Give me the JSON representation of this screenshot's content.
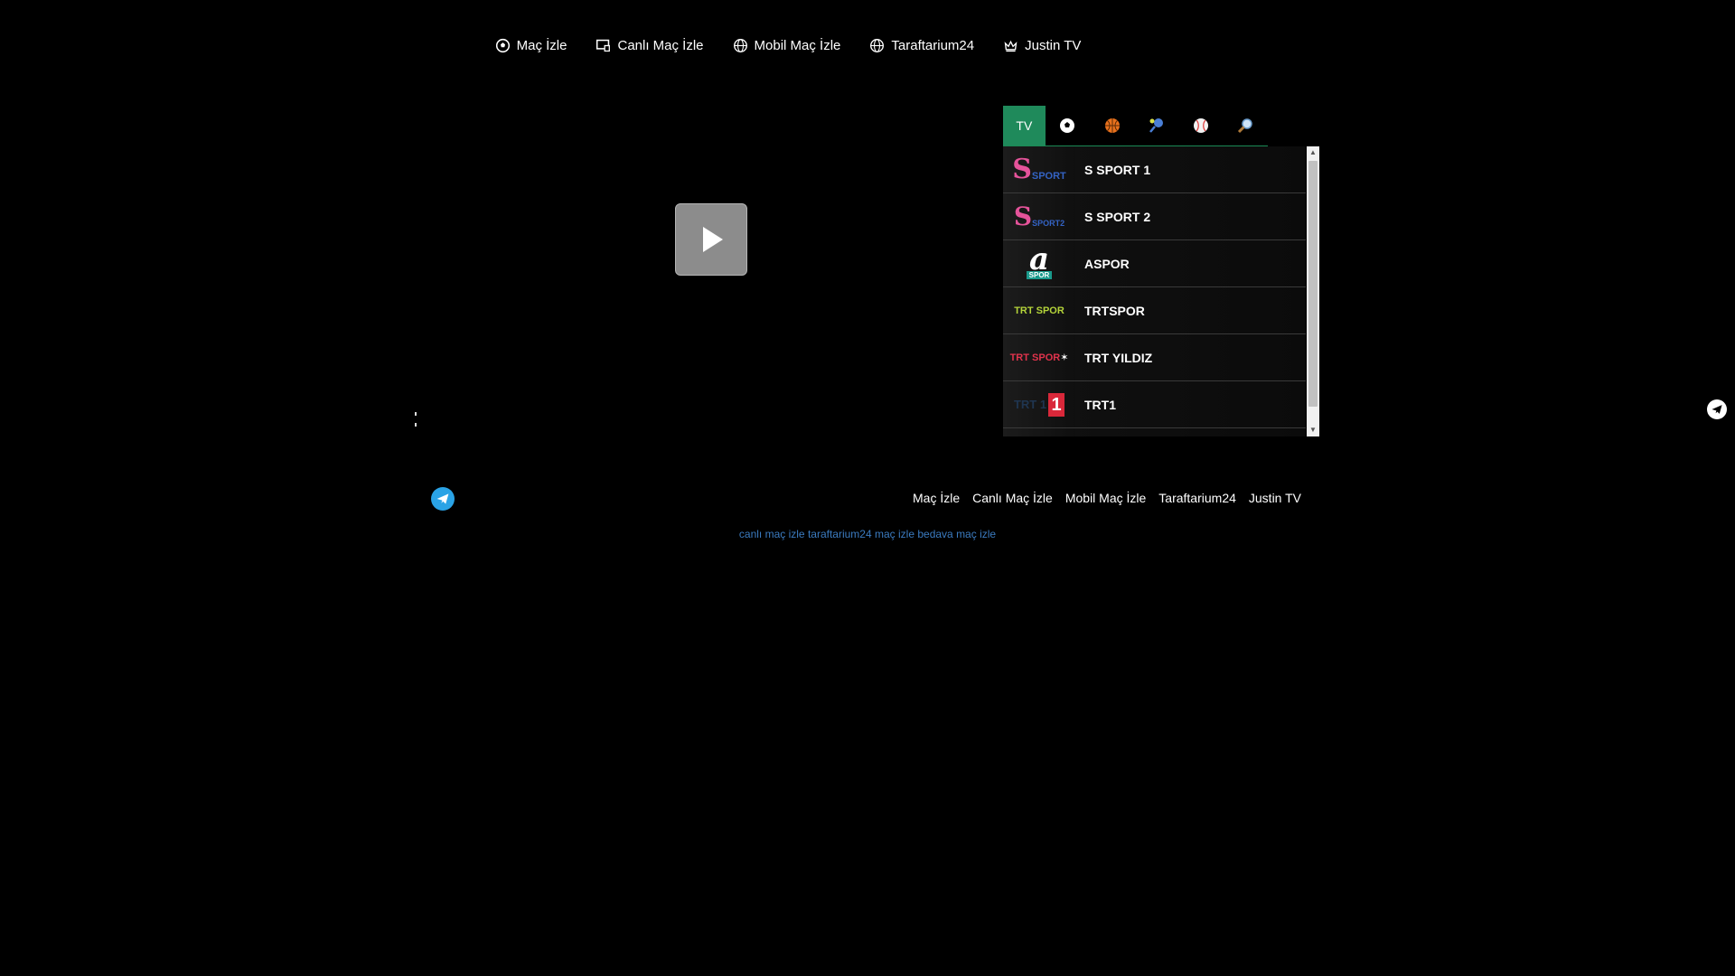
{
  "nav": {
    "items": [
      {
        "label": "Maç İzle",
        "icon": "soccer-ball-icon"
      },
      {
        "label": "Canlı Maç İzle",
        "icon": "screen-icon"
      },
      {
        "label": "Mobil Maç İzle",
        "icon": "globe-icon"
      },
      {
        "label": "Taraftarium24",
        "icon": "globe-icon"
      },
      {
        "label": "Justin TV",
        "icon": "crown-icon"
      }
    ]
  },
  "player": {
    "play_icon": "play-icon"
  },
  "tabs": [
    {
      "label": "TV",
      "icon": ""
    },
    {
      "label": "",
      "icon": "soccer-ball-icon"
    },
    {
      "label": "",
      "icon": "basketball-icon"
    },
    {
      "label": "",
      "icon": "tennis-icon"
    },
    {
      "label": "",
      "icon": "baseball-icon"
    },
    {
      "label": "",
      "icon": "search-icon"
    }
  ],
  "channels": [
    {
      "name": "S SPORT 1",
      "logo_text": "SPORT"
    },
    {
      "name": "S SPORT 2",
      "logo_text": "SPORT2"
    },
    {
      "name": "ASPOR",
      "logo_text": "SPOR"
    },
    {
      "name": "TRTSPOR",
      "logo_text": "TRT SPOR"
    },
    {
      "name": "TRT YILDIZ",
      "logo_text": "TRT SPOR"
    },
    {
      "name": "TRT1",
      "logo_text": "TRT 1"
    },
    {
      "name": "",
      "logo_text": ""
    }
  ],
  "footer": {
    "links": [
      "Maç İzle",
      "Canlı Maç İzle",
      "Mobil Maç İzle",
      "Taraftarium24",
      "Justin TV"
    ],
    "seo_links": [
      "canlı maç izle",
      "taraftarium24",
      "maç izle",
      "bedava maç izle"
    ]
  },
  "colors": {
    "accent": "#1f8a5b",
    "telegram": "#2aa3e6",
    "seo_link": "#3b7bc0"
  }
}
